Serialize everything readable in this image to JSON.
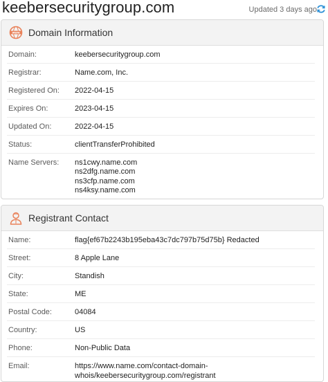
{
  "header": {
    "domain": "keebersecuritygroup.com",
    "updated": "Updated 3 days ago",
    "accent": "#2a8fd6"
  },
  "domain_info": {
    "title": "Domain Information",
    "icon": "www-globe-icon",
    "rows": [
      {
        "label": "Domain:",
        "value": "keebersecuritygroup.com"
      },
      {
        "label": "Registrar:",
        "value": "Name.com, Inc."
      },
      {
        "label": "Registered On:",
        "value": "2022-04-15"
      },
      {
        "label": "Expires On:",
        "value": "2023-04-15"
      },
      {
        "label": "Updated On:",
        "value": "2022-04-15"
      },
      {
        "label": "Status:",
        "value": "clientTransferProhibited"
      }
    ],
    "name_servers_label": "Name Servers:",
    "name_servers": [
      "ns1cwy.name.com",
      "ns2dfg.name.com",
      "ns3cfp.name.com",
      "ns4ksy.name.com"
    ]
  },
  "registrant": {
    "title": "Registrant Contact",
    "icon": "person-icon",
    "rows": [
      {
        "label": "Name:",
        "value": "flag{ef67b2243b195eba43c7dc797b75d75b} Redacted"
      },
      {
        "label": "Street:",
        "value": "8 Apple Lane"
      },
      {
        "label": "City:",
        "value": "Standish"
      },
      {
        "label": "State:",
        "value": "ME"
      },
      {
        "label": "Postal Code:",
        "value": "04084"
      },
      {
        "label": "Country:",
        "value": "US"
      },
      {
        "label": "Phone:",
        "value": "Non-Public Data"
      }
    ],
    "email_label": "Email:",
    "email_lines": [
      "https://www.name.com/contact-domain-",
      "whois/keebersecuritygroup.com/registrant"
    ]
  }
}
